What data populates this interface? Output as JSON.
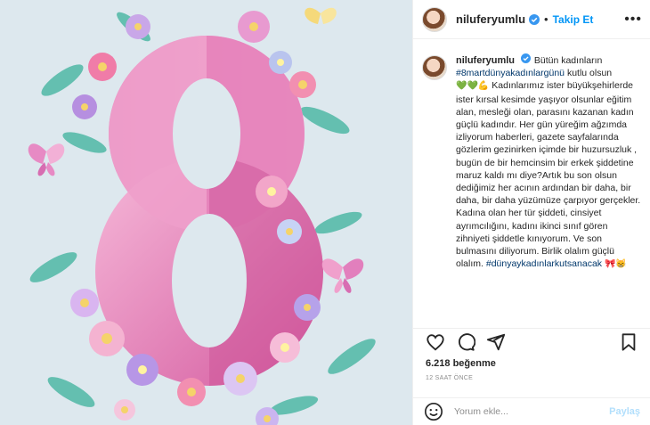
{
  "post": {
    "username": "niluferyumlu",
    "follow_label": "Takip Et",
    "more_label": "•••",
    "separator": "•"
  },
  "caption": {
    "username": "niluferyumlu",
    "line1": "Bütün kadınların",
    "hashtag1": "#8martdünyakadınlargünü",
    "line2": "kutlu olsun",
    "emojis": "💚💚💪",
    "text": "Kadınlarımız ister büyükşehirlerde ister kırsal kesimde yaşıyor olsunlar eğitim alan, mesleği olan, parasını kazanan kadın güçlü kadındır. Her gün yüreğim ağzımda izliyorum haberleri, gazete sayfalarında gözlerim gezinirken içimde bir huzursuzluk , bugün de bir hemcinsim bir erkek şiddetine maruz kaldı mı diye?Artık bu son olsun dediğimiz her acının ardından bir daha, bir daha, bir daha yüzümüze çarpıyor gerçekler. Kadına olan her tür şiddeti, cinsiyet ayrımcılığını, kadını ikinci sınıf gören zihniyeti şiddetle kınıyorum. Ve son bulmasını diliyorum. Birlik olalım güçlü olalım.",
    "hashtag2": "#dünyaykadınlarkutsanacak",
    "end_emojis": "🎀😸"
  },
  "actions": {
    "like": "heart-icon",
    "comment": "comment-icon",
    "share": "send-icon",
    "save": "bookmark-icon"
  },
  "likes_text": "6.218 beğenme",
  "time_text": "12 SAAT ÖNCE",
  "comment_box": {
    "placeholder": "Yorum ekle...",
    "submit_label": "Paylaş"
  },
  "image": {
    "numeral": "8",
    "colors": {
      "bg": "#dfe9ee",
      "pink_dark": "#d96aa8",
      "pink_light": "#f1a9cf",
      "accent": "#0095f6"
    }
  }
}
